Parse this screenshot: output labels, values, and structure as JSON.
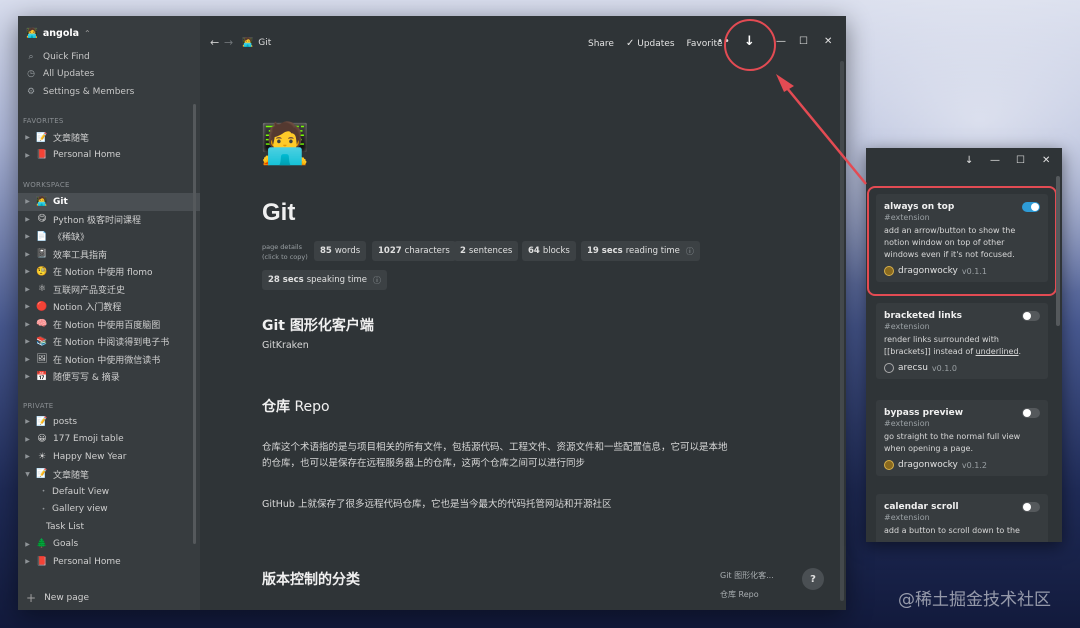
{
  "sidebar": {
    "workspace": "angola",
    "workspace_emoji": "🧑‍💻",
    "workspace_chevron": "⌃",
    "top_items": [
      {
        "icon": "⌕",
        "label": "Quick Find"
      },
      {
        "icon": "◷",
        "label": "All Updates"
      },
      {
        "icon": "⚙",
        "label": "Settings & Members"
      }
    ],
    "favorites_label": "FAVORITES",
    "favorites": [
      {
        "emoji": "📝",
        "label": "文章随笔"
      },
      {
        "emoji": "📕",
        "label": "Personal Home"
      }
    ],
    "workspace_label": "WORKSPACE",
    "workspace_items": [
      {
        "emoji": "🧑‍💻",
        "label": "Git",
        "active": true
      },
      {
        "emoji": "😋",
        "label": "Python 极客时间课程"
      },
      {
        "emoji": "📄",
        "label": "《稀缺》"
      },
      {
        "emoji": "📓",
        "label": "效率工具指南"
      },
      {
        "emoji": "🧐",
        "label": "在 Notion 中使用 flomo"
      },
      {
        "emoji": "⚛",
        "label": "互联网产品变迁史"
      },
      {
        "emoji": "🔴",
        "label": "Notion 入门教程"
      },
      {
        "emoji": "🧠",
        "label": "在 Notion 中使用百度脑图"
      },
      {
        "emoji": "📚",
        "label": "在 Notion 中阅读得到电子书"
      },
      {
        "emoji": "🖼",
        "label": "在 Notion 中使用微信读书"
      },
      {
        "emoji": "📅",
        "label": "随便写写 & 摘录"
      }
    ],
    "private_label": "PRIVATE",
    "private_items": [
      {
        "emoji": "📝",
        "label": "posts",
        "level": 0
      },
      {
        "emoji": "😀",
        "label": "177 Emoji table",
        "level": 0
      },
      {
        "emoji": "☀",
        "label": "Happy New Year",
        "level": 0
      },
      {
        "emoji": "📝",
        "label": "文章随笔",
        "level": 0,
        "open": true
      },
      {
        "emoji": "",
        "label": "Default View",
        "level": 1
      },
      {
        "emoji": "",
        "label": "Gallery view",
        "level": 1
      },
      {
        "emoji": "",
        "label": "Task List",
        "level": 2
      },
      {
        "emoji": "🌲",
        "label": "Goals",
        "level": 0
      },
      {
        "emoji": "📕",
        "label": "Personal Home",
        "level": 0
      }
    ],
    "new_page": "New page"
  },
  "topbar": {
    "back": "←",
    "forward": "→",
    "crumb_emoji": "🧑‍💻",
    "crumb": "Git",
    "share": "Share",
    "updates": "Updates",
    "favorite": "Favorite",
    "more": "••",
    "arrow": "↓",
    "minimize": "—",
    "maximize": "☐",
    "close": "✕"
  },
  "page": {
    "icon": "🧑‍💻",
    "title": "Git",
    "details_label_1": "page details",
    "details_label_2": "(click to copy)",
    "chips": [
      {
        "num": "85",
        "unit": "words"
      },
      {
        "num": "1027",
        "unit": "characters"
      },
      {
        "num": "2",
        "unit": "sentences"
      },
      {
        "num": "64",
        "unit": "blocks"
      },
      {
        "num": "19 secs",
        "unit": "reading time"
      },
      {
        "num": "28 secs",
        "unit": "speaking time"
      }
    ],
    "info_icon": "ⓘ",
    "h1": "Git 图形化客户端",
    "p1": "GitKraken",
    "h2_bold": "仓库",
    "h2_rest": " Repo",
    "p2_line1": "仓库这个术语指的是与项目相关的所有文件，包括源代码、工程文件、资源文件和一些配置信息，它可以是本地",
    "p2_line2": "的仓库，也可以是保存在远程服务器上的仓库，这两个仓库之间可以进行同步",
    "p3": "GitHub 上就保存了很多远程代码仓库，它也是当今最大的代码托管网站和开源社区",
    "h3": "版本控制的分类",
    "toc": [
      "Git 图形化客...",
      "仓库 Repo"
    ],
    "help": "?"
  },
  "popup": {
    "arrow": "↓",
    "minimize": "—",
    "maximize": "☐",
    "close": "✕",
    "extensions": [
      {
        "name": "always on top",
        "tag": "#extension",
        "desc": "add an arrow/button to show the notion window on top of other windows even if it's not focused.",
        "author": "dragonwocky",
        "version": "v0.1.1",
        "enabled": true
      },
      {
        "name": "bracketed links",
        "tag": "#extension",
        "desc_a": "render links surrounded with [[brackets]] instead of ",
        "desc_u": "underlined",
        "desc_b": ".",
        "author": "arecsu",
        "version": "v0.1.0",
        "enabled": false
      },
      {
        "name": "bypass preview",
        "tag": "#extension",
        "desc": "go straight to the normal full view when opening a page.",
        "author": "dragonwocky",
        "version": "v0.1.2",
        "enabled": false
      },
      {
        "name": "calendar scroll",
        "tag": "#extension",
        "desc": "add a button to scroll down to the",
        "enabled": false
      }
    ]
  },
  "watermark": "@稀土掘金技术社区",
  "colors": {
    "highlight": "#e34b53",
    "toggle_on": "#2e9bd6",
    "sidebar_bg": "#373c3f",
    "main_bg": "#2f3437"
  }
}
